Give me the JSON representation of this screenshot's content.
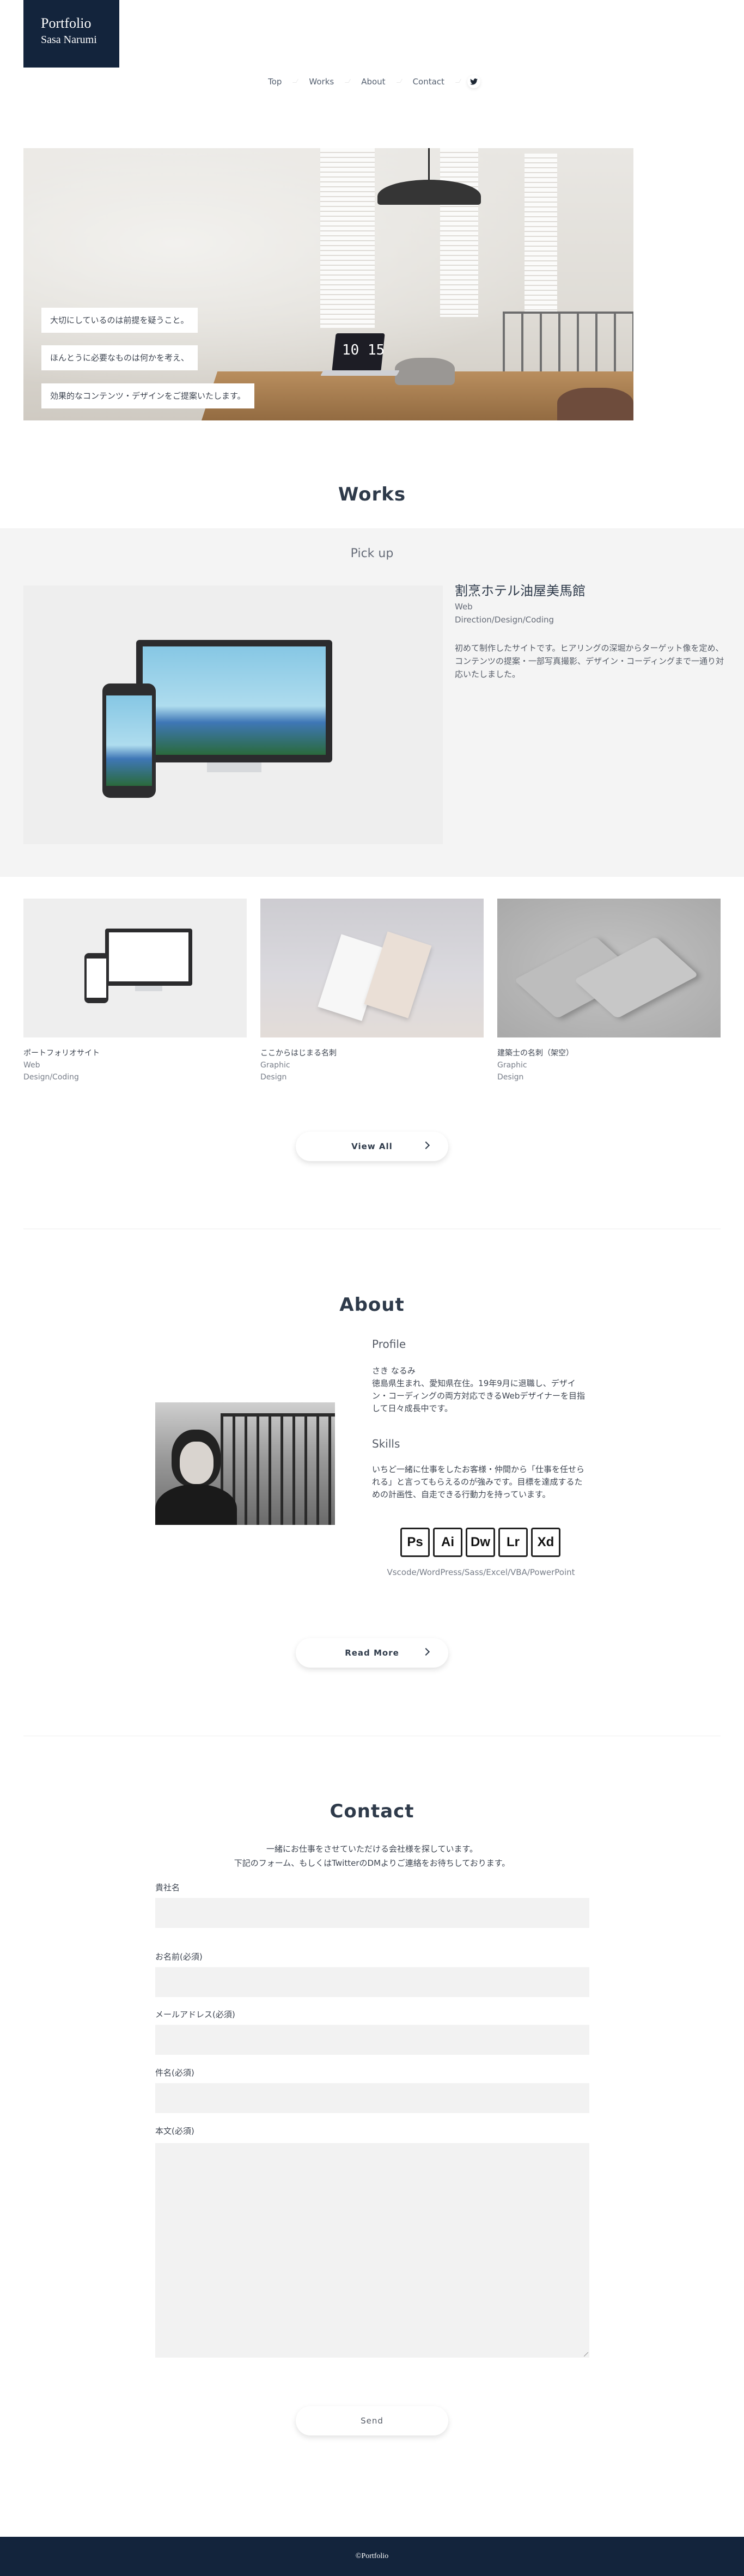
{
  "logo": {
    "line1": "Portfolio",
    "line2": "Sasa Narumi"
  },
  "nav": {
    "items": [
      "Top",
      "Works",
      "About",
      "Contact"
    ],
    "twitter_icon": "twitter-bird-icon"
  },
  "hero": {
    "messages": [
      "大切にしているのは前提を疑うこと。",
      "ほんとうに必要なものは何かを考え、",
      "効果的なコンテンツ・デザインをご提案いたします。"
    ],
    "clock_text": "10 15"
  },
  "works": {
    "title": "Works",
    "pickup": {
      "heading": "Pick up",
      "title": "割烹ホテル油屋美馬館",
      "category": "Web",
      "roles": "Direction/Design/Coding",
      "description": "初めて制作したサイトです。ヒアリングの深堀からターゲット像を定め、コンテンツの提案・一部写真撮影、デザイン・コーディングまで一通り対応いたしました。"
    },
    "cards": [
      {
        "name": "ポートフォリオサイト",
        "category": "Web",
        "roles": "Design/Coding"
      },
      {
        "name": "ここからはじまる名刺",
        "category": "Graphic",
        "roles": "Design"
      },
      {
        "name": "建築士の名刺（架空）",
        "category": "Graphic",
        "roles": "Design"
      }
    ],
    "view_all": "View All"
  },
  "about": {
    "title": "About",
    "profile_heading": "Profile",
    "profile_text": "さき なるみ\n徳島県生まれ、愛知県在住。19年9月に退職し、デザイン・コーディングの両方対応できるWebデザイナーを目指して日々成長中です。",
    "skills_heading": "Skills",
    "skills_text": "いちど一緒に仕事をしたお客様・仲間から「仕事を任せられる」と言ってもらえるのが強みです。目標を達成するための計画性、自走できる行動力を持っています。",
    "skill_badges": [
      "Ps",
      "Ai",
      "Dw",
      "Lr",
      "Xd"
    ],
    "tools": "Vscode/WordPress/Sass/Excel/VBA/PowerPoint",
    "read_more": "Read More"
  },
  "contact": {
    "title": "Contact",
    "intro_line1": "一緒にお仕事をさせていただける会社様を探しています。",
    "intro_line2": "下記のフォーム、もしくはTwitterのDMよりご連絡をお待ちしております。",
    "fields": {
      "company": "貴社名",
      "name": "お名前(必須)",
      "email": "メールアドレス(必須)",
      "subject": "件名(必須)",
      "body": "本文(必須)"
    },
    "send": "Send"
  },
  "footer": {
    "copyright": "©Portfolio"
  },
  "colors": {
    "navy": "#13243c",
    "band": "#f4f4f4",
    "field": "#f2f2f2"
  }
}
